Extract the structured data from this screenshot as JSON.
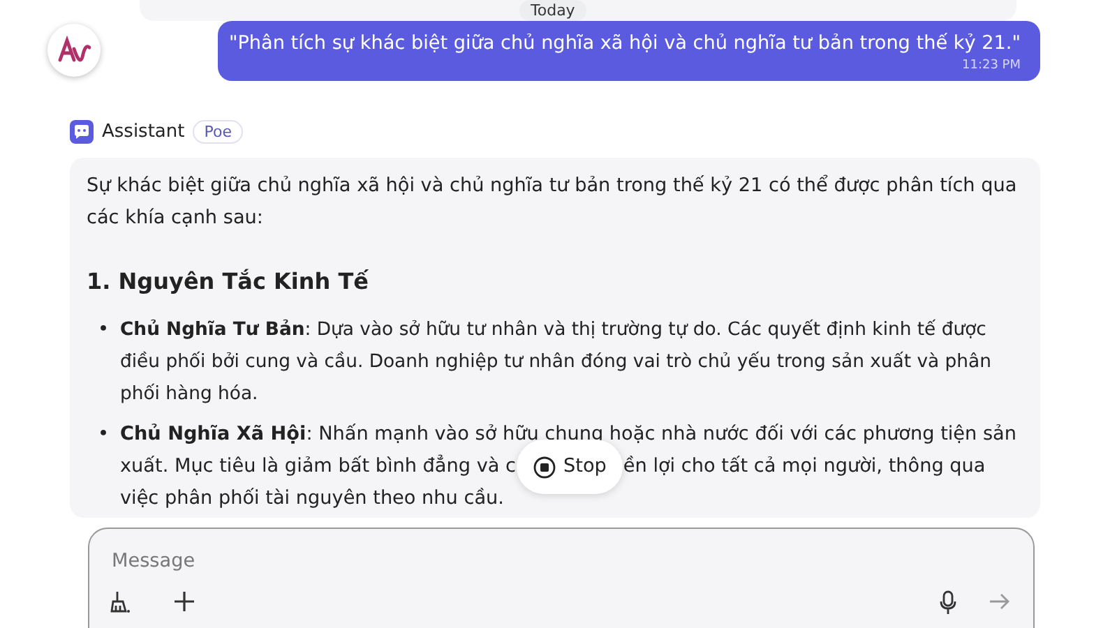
{
  "date_divider": "Today",
  "user_message": {
    "text": "\"Phân tích sự khác biệt giữa chủ nghĩa xã hội và chủ nghĩa tư bản trong thế kỷ 21.\"",
    "time": "11:23 PM"
  },
  "assistant": {
    "name": "Assistant",
    "badge": "Poe"
  },
  "answer": {
    "intro": "Sự khác biệt giữa chủ nghĩa xã hội và chủ nghĩa tư bản trong thế kỷ 21 có thể được phân tích qua các khía cạnh sau:",
    "heading": "1. Nguyên Tắc Kinh Tế",
    "bullets": [
      {
        "marker": "•",
        "text": "**Chủ Nghĩa Tư Bản**: Dựa vào sở hữu tư nhân và thị trường tự do. Các quyết định kinh tế được điều phối bởi cung và cầu. Doanh nghiệp tư nhân đóng vai trò chủ yếu trong sản xuất và phân phối hàng hóa."
      },
      {
        "marker": "•",
        "text": "**Chủ Nghĩa Xã Hội**: Nhấn mạnh vào sở hữu chung hoặc nhà nước đối với các phương tiện sản",
        "text_before_stop": "xuất. Mục tiêu là giảm bất bình đẳng và c",
        "text_after_stop": "ền lợi cho tất cả mọi người, thông qua",
        "text_end": "việc phân phối tài nguyên theo nhu cầu."
      }
    ]
  },
  "stop_button": {
    "label": "Stop"
  },
  "composer": {
    "placeholder": "Message"
  }
}
